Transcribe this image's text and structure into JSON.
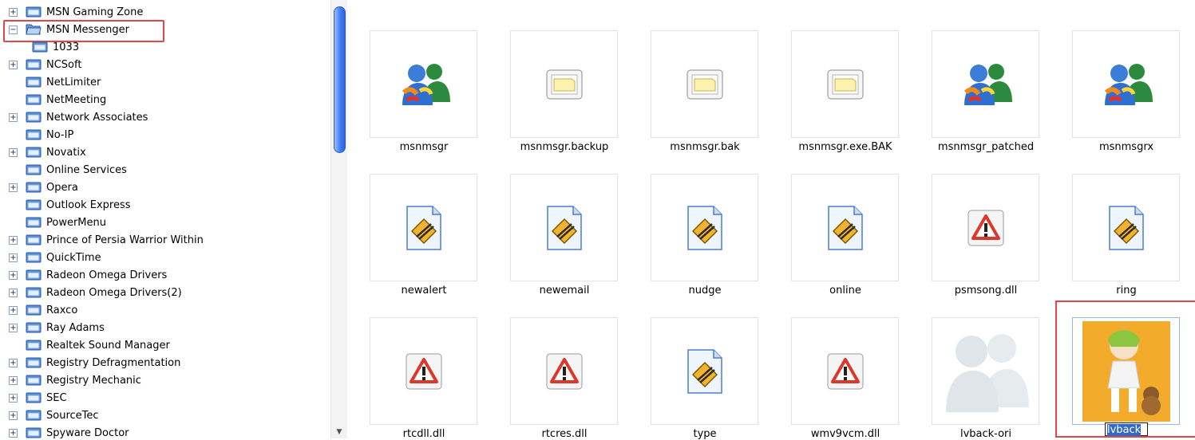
{
  "tree": {
    "items": [
      {
        "label": "MSN Gaming Zone",
        "expander": "+"
      },
      {
        "label": "MSN Messenger",
        "expander": "−",
        "open": true
      },
      {
        "label": "1033",
        "expander": ""
      },
      {
        "label": "NCSoft",
        "expander": "+"
      },
      {
        "label": "NetLimiter",
        "expander": ""
      },
      {
        "label": "NetMeeting",
        "expander": ""
      },
      {
        "label": "Network Associates",
        "expander": "+"
      },
      {
        "label": "No-IP",
        "expander": ""
      },
      {
        "label": "Novatix",
        "expander": "+"
      },
      {
        "label": "Online Services",
        "expander": ""
      },
      {
        "label": "Opera",
        "expander": "+"
      },
      {
        "label": "Outlook Express",
        "expander": ""
      },
      {
        "label": "PowerMenu",
        "expander": ""
      },
      {
        "label": "Prince of Persia Warrior Within",
        "expander": "+"
      },
      {
        "label": "QuickTime",
        "expander": "+"
      },
      {
        "label": "Radeon Omega Drivers",
        "expander": "+"
      },
      {
        "label": "Radeon Omega Drivers(2)",
        "expander": "+"
      },
      {
        "label": "Raxco",
        "expander": "+"
      },
      {
        "label": "Ray Adams",
        "expander": "+"
      },
      {
        "label": "Realtek Sound Manager",
        "expander": ""
      },
      {
        "label": "Registry Defragmentation",
        "expander": "+"
      },
      {
        "label": "Registry Mechanic",
        "expander": "+"
      },
      {
        "label": "SEC",
        "expander": "+"
      },
      {
        "label": "SourceTec",
        "expander": "+"
      },
      {
        "label": "Spyware Doctor",
        "expander": "+"
      }
    ]
  },
  "files": [
    {
      "name": "msnmsgr",
      "icon": "msn-messenger-icon"
    },
    {
      "name": "msnmsgr.backup",
      "icon": "generic-file-icon"
    },
    {
      "name": "msnmsgr.bak",
      "icon": "generic-file-icon"
    },
    {
      "name": "msnmsgr.exe.BAK",
      "icon": "generic-file-icon"
    },
    {
      "name": "msnmsgr_patched",
      "icon": "msn-messenger-icon"
    },
    {
      "name": "msnmsgrx",
      "icon": "msn-messenger-icon"
    },
    {
      "name": "newalert",
      "icon": "winamp-audio-icon"
    },
    {
      "name": "newemail",
      "icon": "winamp-audio-icon"
    },
    {
      "name": "nudge",
      "icon": "winamp-audio-icon"
    },
    {
      "name": "online",
      "icon": "winamp-audio-icon"
    },
    {
      "name": "psmsong.dll",
      "icon": "warning-dll-icon"
    },
    {
      "name": "ring",
      "icon": "winamp-audio-icon"
    },
    {
      "name": "rtcdll.dll",
      "icon": "warning-dll-icon"
    },
    {
      "name": "rtcres.dll",
      "icon": "warning-dll-icon"
    },
    {
      "name": "type",
      "icon": "winamp-audio-icon"
    },
    {
      "name": "wmv9vcm.dll",
      "icon": "warning-dll-icon"
    },
    {
      "name": "lvback-ori",
      "icon": "msn-faded-icon"
    },
    {
      "name": "lvback",
      "icon": "anime-image-thumbnail",
      "renaming": true
    }
  ],
  "colors": {
    "highlight": "#e0474c",
    "selection": "#316ac5"
  }
}
